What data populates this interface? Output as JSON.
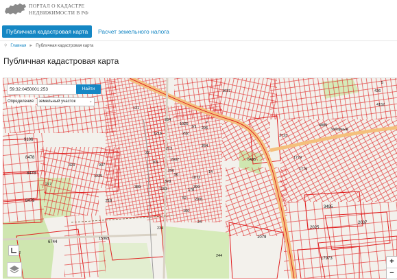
{
  "header": {
    "logo_line1": "ПОРТАЛ О КАДАСТРЕ",
    "logo_line2": "НЕДВИЖИМОСТИ В РФ"
  },
  "nav": {
    "tabs": [
      {
        "label": "Публичная кадастровая карта",
        "active": true
      },
      {
        "label": "Расчет земельного налога",
        "active": false
      }
    ]
  },
  "breadcrumb": {
    "home": "Главная",
    "sep": "►",
    "current": "Публичная кадастровая карта"
  },
  "page_title": "Публичная кадастровая карта",
  "map": {
    "search_value": "59:32:0450001:253",
    "find_button": "Найти",
    "definition_label": "Определение:",
    "definition_value": "земельный участок",
    "zoom_in": "+",
    "zoom_out": "−",
    "parcel_labels": [
      "9106",
      "8478",
      "8479",
      "8478",
      "6744",
      "937",
      "323",
      "1225",
      "389",
      "217",
      "218",
      "1216",
      "1026",
      "3/1",
      "121",
      "24",
      "100",
      "2001",
      "399",
      "250",
      "244",
      "1079",
      "2025",
      "3495",
      "2037",
      "17973",
      "3723",
      "1779",
      "1779",
      "4889",
      "6485",
      "1037",
      "436",
      "4152",
      "5",
      "Заборный",
      "6142",
      "15965",
      "234",
      "22",
      "2007",
      "101",
      "378",
      "1253",
      "52",
      "264",
      "292",
      "296",
      "212",
      "96",
      "1072",
      "178",
      "264",
      "14",
      "7"
    ],
    "colors": {
      "parcel_line": "#e02020",
      "accent": "#1587c4",
      "green": "#c9e4a4",
      "road": "#f7c98c"
    }
  }
}
